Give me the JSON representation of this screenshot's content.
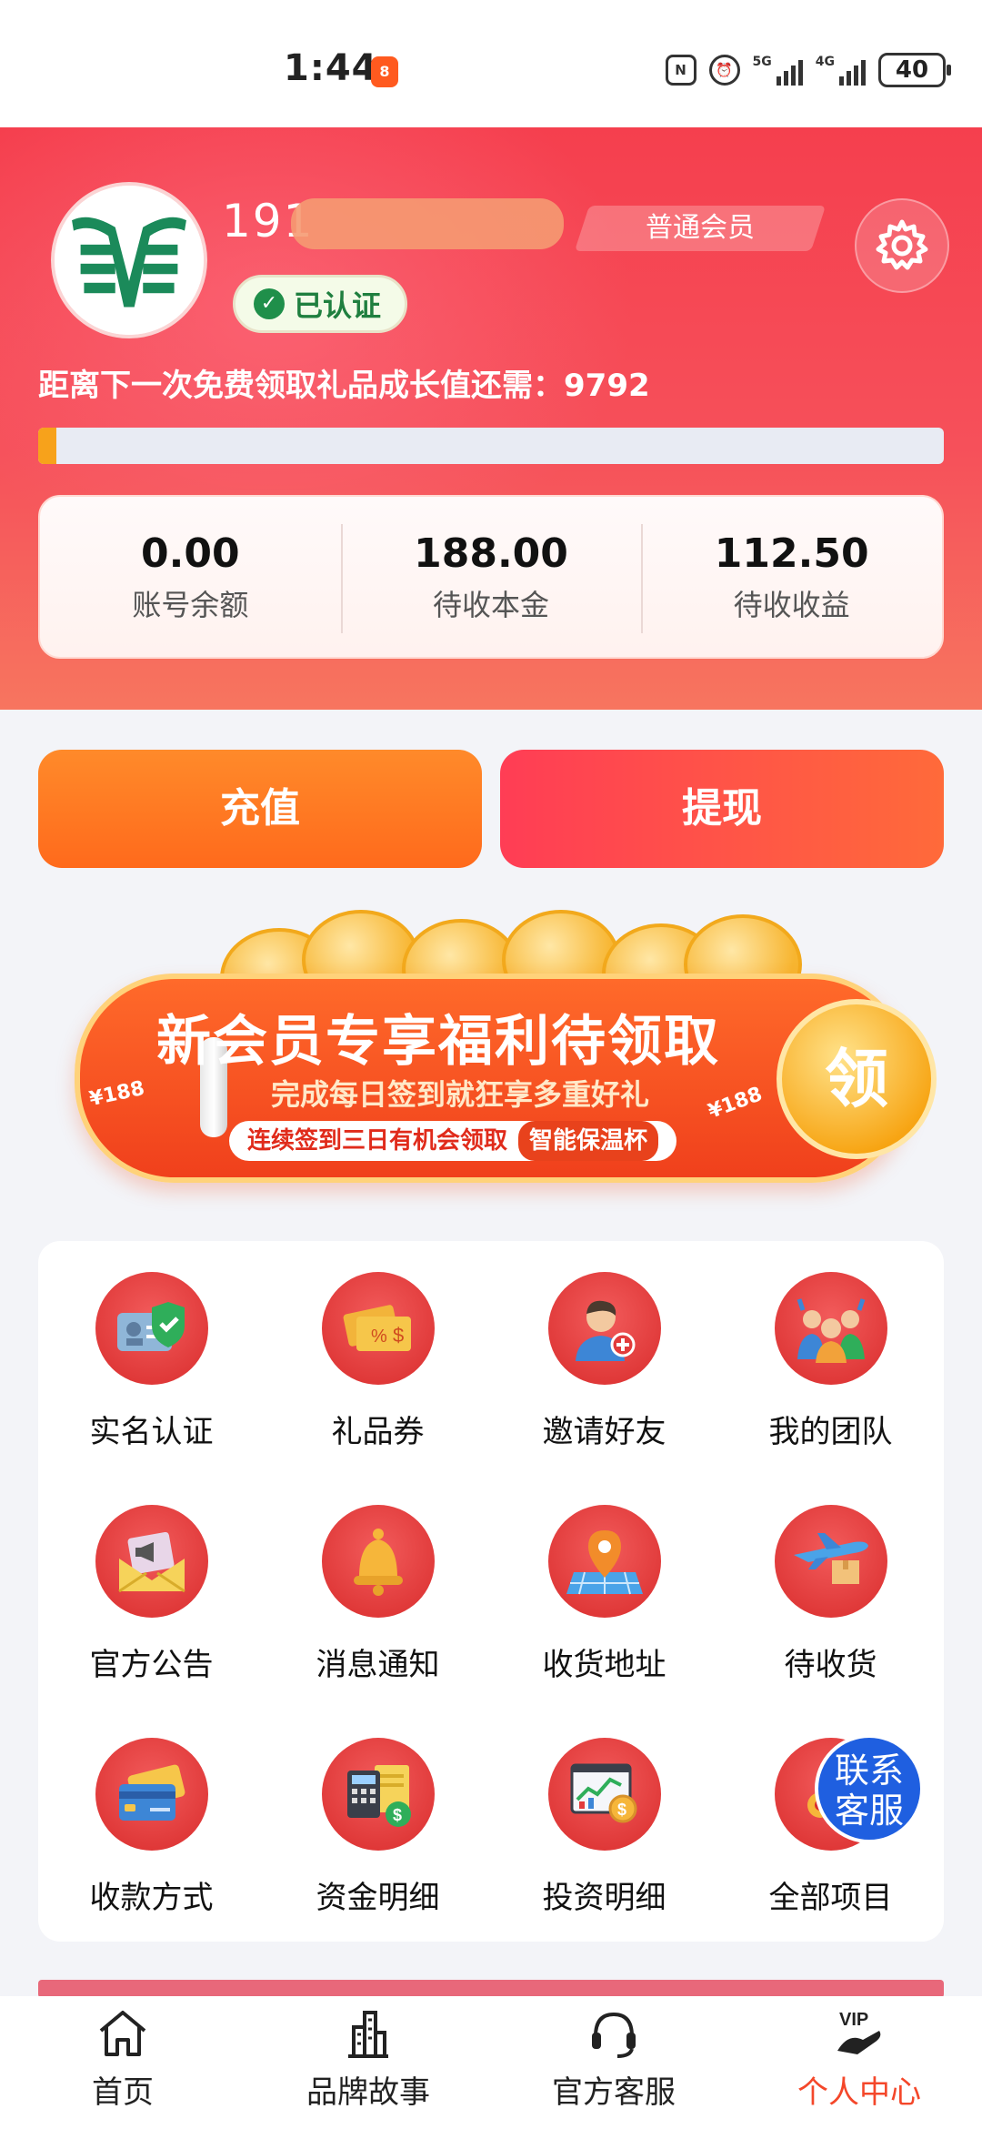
{
  "status_bar": {
    "time": "1:44",
    "battery": "40",
    "net1": "5G",
    "net2": "4G"
  },
  "profile": {
    "phone_visible": "191",
    "member_level": "普通会员",
    "verified_label": "已认证",
    "growth_text": "距离下一次免费领取礼品成长值还需：9792",
    "progress_fraction": 0.02
  },
  "stats": [
    {
      "value": "0.00",
      "label": "账号余额"
    },
    {
      "value": "188.00",
      "label": "待收本金"
    },
    {
      "value": "112.50",
      "label": "待收收益"
    }
  ],
  "actions": {
    "recharge": "充值",
    "withdraw": "提现"
  },
  "banner": {
    "title": "新会员专享福利待领取",
    "subtitle": "完成每日签到就狂享多重好礼",
    "pill_text": "连续签到三日有机会领取",
    "pill_highlight": "智能保温杯",
    "claim": "领",
    "coupon_left": "¥188",
    "coupon_right": "¥188"
  },
  "grid": [
    {
      "label": "实名认证",
      "icon": "id-card-icon"
    },
    {
      "label": "礼品券",
      "icon": "coupon-icon"
    },
    {
      "label": "邀请好友",
      "icon": "invite-friend-icon"
    },
    {
      "label": "我的团队",
      "icon": "team-icon"
    },
    {
      "label": "官方公告",
      "icon": "announcement-icon"
    },
    {
      "label": "消息通知",
      "icon": "bell-icon"
    },
    {
      "label": "收货地址",
      "icon": "map-pin-icon"
    },
    {
      "label": "待收货",
      "icon": "plane-box-icon"
    },
    {
      "label": "收款方式",
      "icon": "card-icon"
    },
    {
      "label": "资金明细",
      "icon": "calculator-icon"
    },
    {
      "label": "投资明细",
      "icon": "chart-coin-icon"
    },
    {
      "label": "全部项目",
      "icon": "gear-icon"
    }
  ],
  "contact": {
    "line1": "联系",
    "line2": "客服"
  },
  "nav": [
    {
      "label": "首页",
      "icon": "home-icon"
    },
    {
      "label": "品牌故事",
      "icon": "building-icon"
    },
    {
      "label": "官方客服",
      "icon": "headset-icon"
    },
    {
      "label": "个人中心",
      "icon": "vip-icon"
    }
  ],
  "colors": {
    "accent": "#f4472a",
    "header_red": "#f53f4e",
    "orange": "#ff7a22"
  }
}
